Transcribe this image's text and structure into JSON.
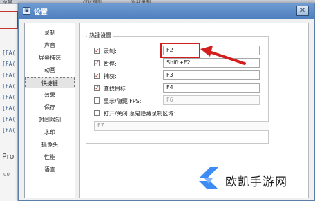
{
  "background": {
    "menu": [
      "草果",
      "改化录制",
      "管我录制"
    ],
    "log_lines": [
      "[FA(",
      "[FA(",
      "[FA(",
      "[FA(",
      "[FA(",
      "[FA(",
      "[FA(",
      "[FA("
    ],
    "pro_label": "Pro",
    "pro_sub": "00"
  },
  "dialog": {
    "title": "设置",
    "title_icon": "▣",
    "close_label": "✕"
  },
  "nav": {
    "items": [
      {
        "label": "录制"
      },
      {
        "label": "声音"
      },
      {
        "label": "屏幕捕获"
      },
      {
        "label": "动画"
      },
      {
        "label": "快捷键"
      },
      {
        "label": "效果"
      },
      {
        "label": "保存"
      },
      {
        "label": "时间限制"
      },
      {
        "label": "水印"
      },
      {
        "label": "摄像头"
      },
      {
        "label": "性能"
      },
      {
        "label": "语言"
      }
    ],
    "selected": "快捷键"
  },
  "hotkeys": {
    "group_title": "热键设置",
    "rows": [
      {
        "label": "录制:",
        "checked": true,
        "value": "F2"
      },
      {
        "label": "暂停:",
        "checked": true,
        "value": "Shift+F2"
      },
      {
        "label": "捕获:",
        "checked": true,
        "value": "F3"
      },
      {
        "label": "查找目标:",
        "checked": true,
        "value": "F4"
      },
      {
        "label": "显示/隐藏 FPS:",
        "checked": false,
        "value": "F6"
      }
    ],
    "overlay_row": {
      "label": "打开/关闭 总是隐藏录制区域：",
      "checked": false,
      "value": "F7"
    },
    "check_mark": "✓"
  },
  "watermark": {
    "text": "欧凯手游网"
  },
  "colors": {
    "title_bar": "#4f7fbf",
    "annotation_red": "#d41e1e",
    "checkbox_red": "#c0392b",
    "watermark_blue": "#3d8cf5"
  }
}
